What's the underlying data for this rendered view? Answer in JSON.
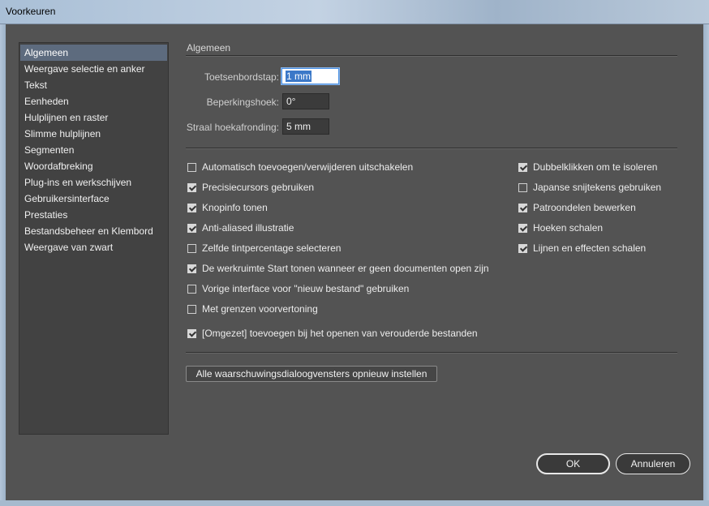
{
  "window": {
    "title": "Voorkeuren"
  },
  "sidebar": {
    "items": [
      {
        "label": "Algemeen",
        "selected": true
      },
      {
        "label": "Weergave selectie en anker"
      },
      {
        "label": "Tekst"
      },
      {
        "label": "Eenheden"
      },
      {
        "label": "Hulplijnen en raster"
      },
      {
        "label": "Slimme hulplijnen"
      },
      {
        "label": "Segmenten"
      },
      {
        "label": "Woordafbreking"
      },
      {
        "label": "Plug-ins en werkschijven"
      },
      {
        "label": "Gebruikersinterface"
      },
      {
        "label": "Prestaties"
      },
      {
        "label": "Bestandsbeheer en Klembord"
      },
      {
        "label": "Weergave van zwart"
      }
    ]
  },
  "section": {
    "title": "Algemeen"
  },
  "fields": {
    "keyboard_increment": {
      "label": "Toetsenbordstap:",
      "value": "1 mm"
    },
    "constrain_angle": {
      "label": "Beperkingshoek:",
      "value": "0°"
    },
    "corner_radius": {
      "label": "Straal hoekafronding:",
      "value": "5 mm"
    }
  },
  "checkboxes_left": [
    {
      "label": "Automatisch toevoegen/verwijderen uitschakelen",
      "checked": false
    },
    {
      "label": "Precisiecursors gebruiken",
      "checked": true
    },
    {
      "label": "Knopinfo tonen",
      "checked": true
    },
    {
      "label": "Anti-aliased illustratie",
      "checked": true
    },
    {
      "label": "Zelfde tintpercentage selecteren",
      "checked": false
    },
    {
      "label": "De werkruimte Start tonen wanneer er geen documenten open zijn",
      "checked": true
    },
    {
      "label": "Vorige interface voor \"nieuw bestand\" gebruiken",
      "checked": false
    },
    {
      "label": "Met grenzen voorvertoning",
      "checked": false
    },
    {
      "label": "[Omgezet] toevoegen bij het openen van verouderde bestanden",
      "checked": true
    }
  ],
  "checkboxes_right": [
    {
      "label": "Dubbelklikken om te isoleren",
      "checked": true
    },
    {
      "label": "Japanse snijtekens gebruiken",
      "checked": false
    },
    {
      "label": "Patroondelen bewerken",
      "checked": true
    },
    {
      "label": "Hoeken schalen",
      "checked": true
    },
    {
      "label": "Lijnen en effecten schalen",
      "checked": true
    }
  ],
  "buttons": {
    "reset_warnings": "Alle waarschuwingsdialoogvensters opnieuw instellen",
    "ok": "OK",
    "cancel": "Annuleren"
  }
}
